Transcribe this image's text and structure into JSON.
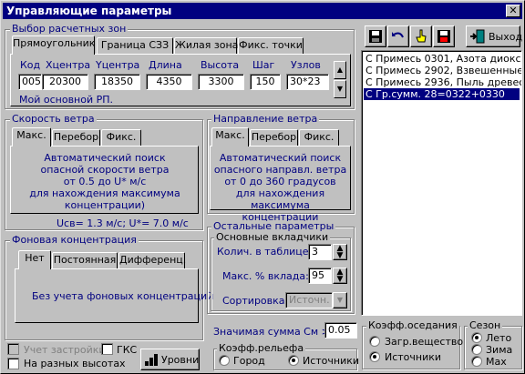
{
  "window": {
    "title": "Управляющие параметры",
    "close_glyph": "✕"
  },
  "calc_zones": {
    "title": "Выбор расчетных зон",
    "tabs": [
      "Прямоугольник",
      "Граница СЗЗ",
      "Жилая зона",
      "Фикс. точки"
    ],
    "fields": [
      {
        "label": "Код",
        "value": "005"
      },
      {
        "label": "Xцентра",
        "value": "20300"
      },
      {
        "label": "Yцентра",
        "value": "18350"
      },
      {
        "label": "Длина",
        "value": "4350"
      },
      {
        "label": "Высота",
        "value": "3300"
      },
      {
        "label": "Шаг",
        "value": "150"
      },
      {
        "label": "Узлов",
        "value": "30*23"
      }
    ],
    "name": "Мой основной РП."
  },
  "wind_speed": {
    "title": "Скорость ветра",
    "tabs": [
      "Макс.",
      "Перебор",
      "Фикс."
    ],
    "desc": [
      "Автоматический поиск",
      "опасной скорости ветра",
      "от 0.5 до U* м/с",
      "для нахождения максимума",
      "концентрации)"
    ],
    "footer": "Uсв= 1.3 м/с; U*= 7.0 м/с"
  },
  "wind_direction": {
    "title": "Направление ветра",
    "tabs": [
      "Макс.",
      "Перебор",
      "Фикс."
    ],
    "desc": [
      "Автоматический поиск",
      "опасного направл. ветра",
      "от 0 до 360 градусов",
      "для нахождения максимума",
      "концентрации"
    ]
  },
  "background": {
    "title": "Фоновая концентрация",
    "tabs": [
      "Нет",
      "Постоянная",
      "Дифференц."
    ],
    "desc": "Без учета фоновых концентраций"
  },
  "other_params": {
    "title": "Остальные параметры",
    "subtitle": "Основные вкладчики",
    "count_label": "Колич. в таблице:",
    "count_value": "3",
    "percent_label": "Макс. % вклада:",
    "percent_value": "95",
    "sort_label": "Сортировка:",
    "sort_value": "Источн."
  },
  "significant_sum": {
    "label": "Значимая сумма См >",
    "value": "0.05"
  },
  "relief": {
    "title": "Коэфф.рельефа",
    "options": [
      "Город",
      "Источники"
    ],
    "selected": 1
  },
  "settling": {
    "title": "Коэфф.оседания",
    "options": [
      "Загр.вещество",
      "Источники"
    ],
    "selected": 1
  },
  "season": {
    "title": "Сезон",
    "options": [
      "Лето",
      "Зима",
      "Max"
    ],
    "selected": 0
  },
  "bottom": {
    "account_building": "Учет застройки",
    "gks": "ГКС",
    "different_heights": "На разных высотах",
    "levels_button": "Уровни"
  },
  "toolbar": {
    "exit_label": "Выход"
  },
  "substances": [
    "С  Примесь 0301, Азота диоксид",
    "С  Примесь 2902, Взвешенные ве",
    "С  Примесь 2936, Пыль древесная",
    "С  Гр.сумм.    28=0322+0330"
  ],
  "selected_substance": 3,
  "colors": {
    "title_bg": "#000080",
    "accent_text": "#000080",
    "face": "#c0c0c0"
  }
}
